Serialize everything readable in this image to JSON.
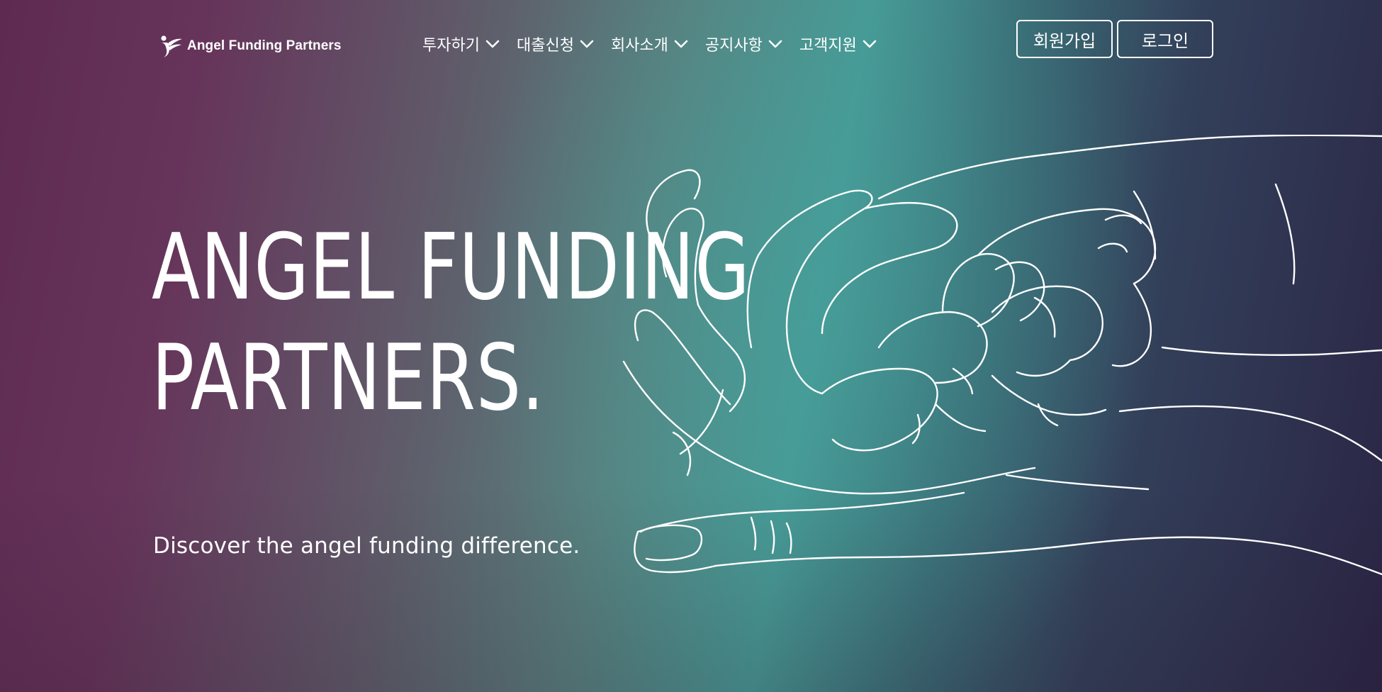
{
  "brand": {
    "name": "Angel Funding Partners",
    "logo_icon": "angel-figure-icon"
  },
  "nav": {
    "items": [
      {
        "label": "투자하기"
      },
      {
        "label": "대출신청"
      },
      {
        "label": "회사소개"
      },
      {
        "label": "공지사항"
      },
      {
        "label": "고객지원"
      }
    ]
  },
  "auth": {
    "signup_label": "회원가입",
    "login_label": "로그인"
  },
  "hero": {
    "headline_line1": "ANGEL FUNDING",
    "headline_line2": "PARTNERS.",
    "tagline": "Discover the angel funding difference.",
    "illustration": "hands-line-art"
  },
  "colors": {
    "gradient_left": "#5e2a52",
    "gradient_mid": "#479a96",
    "gradient_right": "#2a2545",
    "text": "#ffffff"
  }
}
